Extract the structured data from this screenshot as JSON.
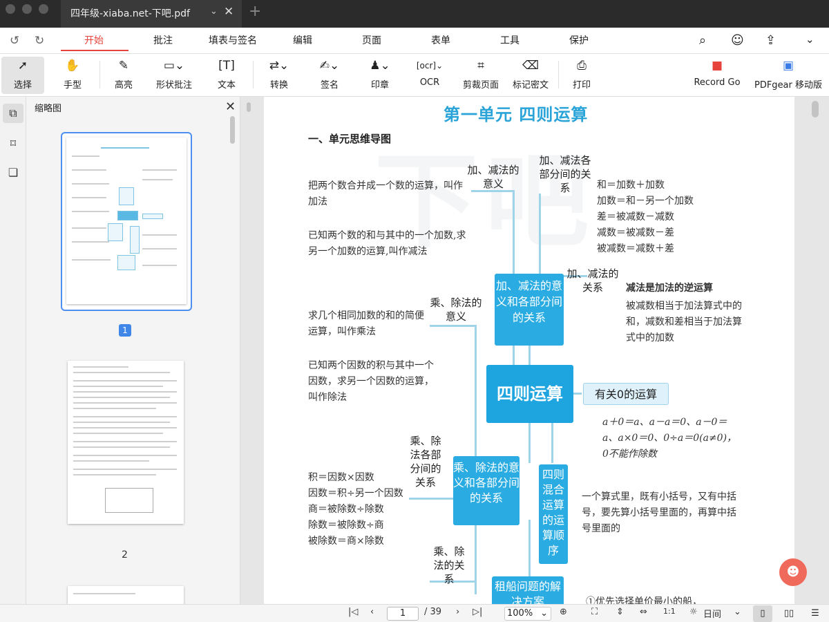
{
  "tab": {
    "title": "四年级-xiaba.net-下吧.pdf"
  },
  "menu": {
    "items": [
      {
        "label": "开始"
      },
      {
        "label": "批注"
      },
      {
        "label": "填表与签名"
      },
      {
        "label": "编辑"
      },
      {
        "label": "页面"
      },
      {
        "label": "表单"
      },
      {
        "label": "工具"
      },
      {
        "label": "保护"
      }
    ]
  },
  "toolbar": {
    "tools": [
      {
        "label": "选择"
      },
      {
        "label": "手型"
      },
      {
        "label": "高亮"
      },
      {
        "label": "形状批注"
      },
      {
        "label": "文本"
      },
      {
        "label": "转换"
      },
      {
        "label": "签名"
      },
      {
        "label": "印章"
      },
      {
        "label": "OCR"
      },
      {
        "label": "剪裁页面"
      },
      {
        "label": "标记密文"
      },
      {
        "label": "打印"
      },
      {
        "label": "Record Go"
      },
      {
        "label": "PDFgear 移动版"
      }
    ],
    "accent": "#e5433b"
  },
  "thumbs": {
    "title": "缩略图",
    "page1": "1",
    "page2": "2"
  },
  "doc": {
    "title": "第一单元    四则运算",
    "section": "一、单元思维导图",
    "t_add_def": "把两个数合并成一个数的运算，叫作加法",
    "t_sub_def": "已知两个数的和与其中的一个加数,求另一个加数的运算,叫作减法",
    "l_add_meaning": "加、减法的意义",
    "l_add_parts": "加、减法各部分间的关系",
    "t_add_rel": [
      "和＝加数＋加数",
      "加数＝和－另一个加数",
      "差＝被减数－减数",
      "减数＝被减数－差",
      "被减数＝减数＋差"
    ],
    "l_add_rel": "加、减法的关系",
    "t_sub_inverse_title": "减法是加法的逆运算",
    "t_sub_inverse": "被减数相当于加法算式中的和，减数和差相当于加法算式中的加数",
    "l_mul_meaning": "乘、除法的意义",
    "t_mul_def": "求几个相同加数的和的简便运算，叫作乘法",
    "t_div_def": "已知两个因数的积与其中一个因数，求另一个因数的运算，叫作除法",
    "n_add": "加、减法的意义和各部分间的关系",
    "n_center": "四则运算",
    "n_zero": "有关0的运算",
    "t_zero": "a＋0＝a、a－a＝0、a－0＝a、a×0＝0、0÷a＝0(a≠0)，0不能作除数",
    "l_mul_parts": "乘、除法各部分间的关系",
    "t_mul_rel": [
      "积＝因数×因数",
      "因数＝积÷另一个因数",
      "商＝被除数÷除数",
      "除数＝被除数÷商",
      "被除数＝商×除数"
    ],
    "n_mul": "乘、除法的意义和各部分间的关系",
    "n_order": "四则混合运算的运算顺序",
    "t_order": "一个算式里，既有小括号，又有中括号，要先算小括号里面的，再算中括号里面的",
    "l_mul_rel": "乘、除法的关系",
    "n_boat": "租船问题的解决方案",
    "t_boat": "①优先选择单价最小的船，"
  },
  "status": {
    "page": "1",
    "total": "/ 39",
    "zoom": "100%",
    "mode": "日间"
  }
}
